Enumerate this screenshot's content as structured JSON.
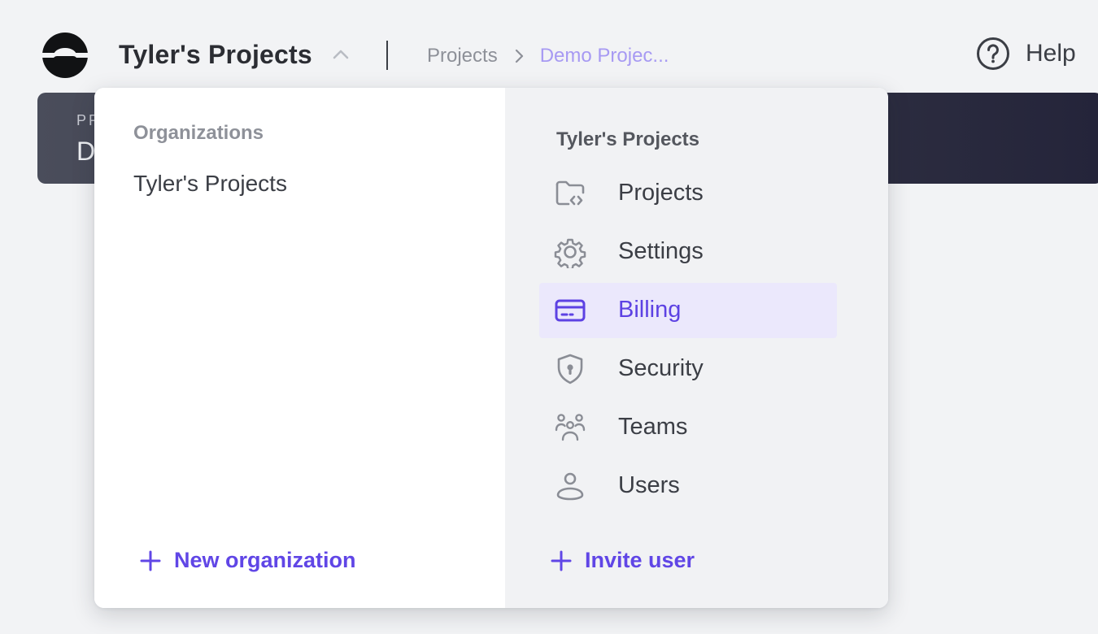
{
  "header": {
    "org_name": "Tyler's Projects",
    "breadcrumbs": {
      "root": "Projects",
      "current": "Demo Projec..."
    },
    "help_label": "Help"
  },
  "background_card": {
    "eyebrow": "PR",
    "title": "D"
  },
  "dropdown": {
    "organizations_heading": "Organizations",
    "organizations": [
      "Tyler's Projects"
    ],
    "new_org_label": "New organization",
    "menu_heading": "Tyler's Projects",
    "menu_items": [
      {
        "label": "Projects",
        "icon": "folder-code-icon",
        "active": false
      },
      {
        "label": "Settings",
        "icon": "gear-icon",
        "active": false
      },
      {
        "label": "Billing",
        "icon": "credit-card-icon",
        "active": true
      },
      {
        "label": "Security",
        "icon": "shield-lock-icon",
        "active": false
      },
      {
        "label": "Teams",
        "icon": "team-icon",
        "active": false
      },
      {
        "label": "Users",
        "icon": "user-icon",
        "active": false
      }
    ],
    "invite_label": "Invite user"
  },
  "colors": {
    "accent": "#6046e6",
    "accent_light": "#ebe8fc",
    "breadcrumb_current": "#a79af3",
    "background": "#f2f3f5"
  }
}
